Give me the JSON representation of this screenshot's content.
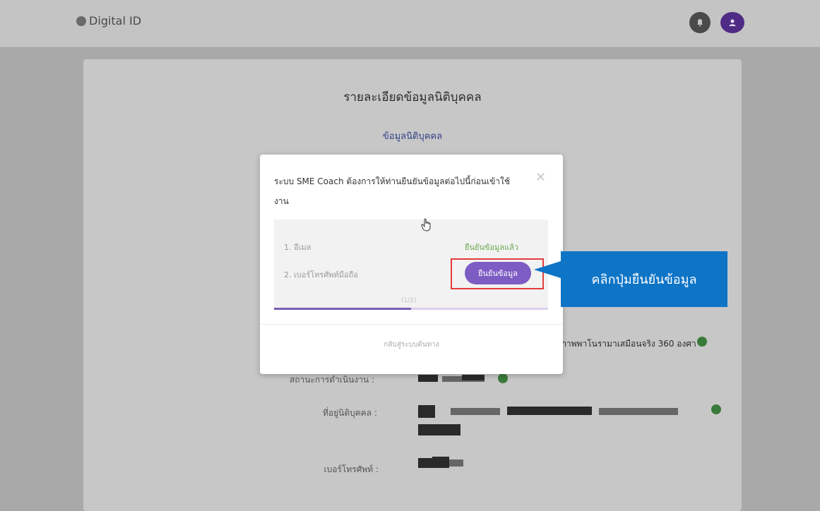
{
  "topbar": {
    "brand": "Digital ID",
    "colors": {
      "bar": "#c4c4c4",
      "user_avatar": "#4f2b86"
    }
  },
  "card": {
    "title": "รายละเอียดข้อมูลนิติบุคคล",
    "subtitle": "ข้อมูลนิติบุคคล",
    "rows": [
      {
        "label": "สถานะการดำเนินงาน :"
      },
      {
        "label": "ที่อยู่นิติบุคคล :"
      },
      {
        "label": "เบอร์โทรศัพท์ :"
      }
    ],
    "visible_text": "ภาพพาโนรามาเสมือนจริง 360 องศา"
  },
  "modal": {
    "message": "ระบบ SME Coach ต้องการให้ท่านยืนยันข้อมูลต่อไปนี้ก่อนเข้าใช้งาน",
    "steps": [
      {
        "label": "1. อีเมล",
        "status": "ยืนยันข้อมูลแล้ว"
      },
      {
        "label": "2. เบอร์โทรศัพท์มือถือ",
        "button": "ยืนยันข้อมูล"
      }
    ],
    "progress_text": "(1/2)",
    "progress": 0.5,
    "back_link": "กลับสู่ระบบต้นทาง",
    "colors": {
      "button": "#7d5cc3",
      "verified": "#6aa84f",
      "progress": "#7b5eb4"
    }
  },
  "callout": {
    "text": "คลิกปุ่มยืนยันข้อมูล",
    "color": "#0e74c6"
  }
}
